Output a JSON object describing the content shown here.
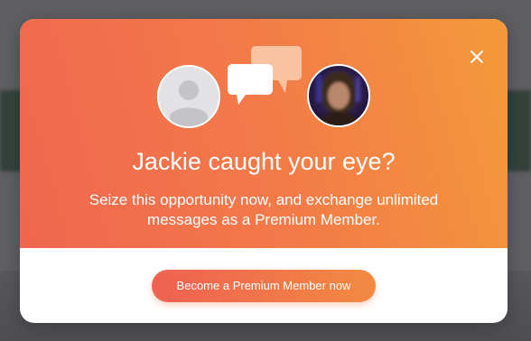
{
  "modal": {
    "headline": "Jackie caught your eye?",
    "subtext_line1": "Seize this opportunity now, and exchange unlimited",
    "subtext_line2": "messages as a Premium Member.",
    "cta_label": "Become a Premium Member now",
    "close_icon": "close-icon",
    "left_avatar_icon": "default-user-icon",
    "chat_icon": "chat-bubbles-icon"
  },
  "colors": {
    "gradient_start": "#f0664f",
    "gradient_end": "#f5993a",
    "cta_start": "#ef6152",
    "cta_end": "#f28a42",
    "backdrop": "#5f5f63"
  }
}
